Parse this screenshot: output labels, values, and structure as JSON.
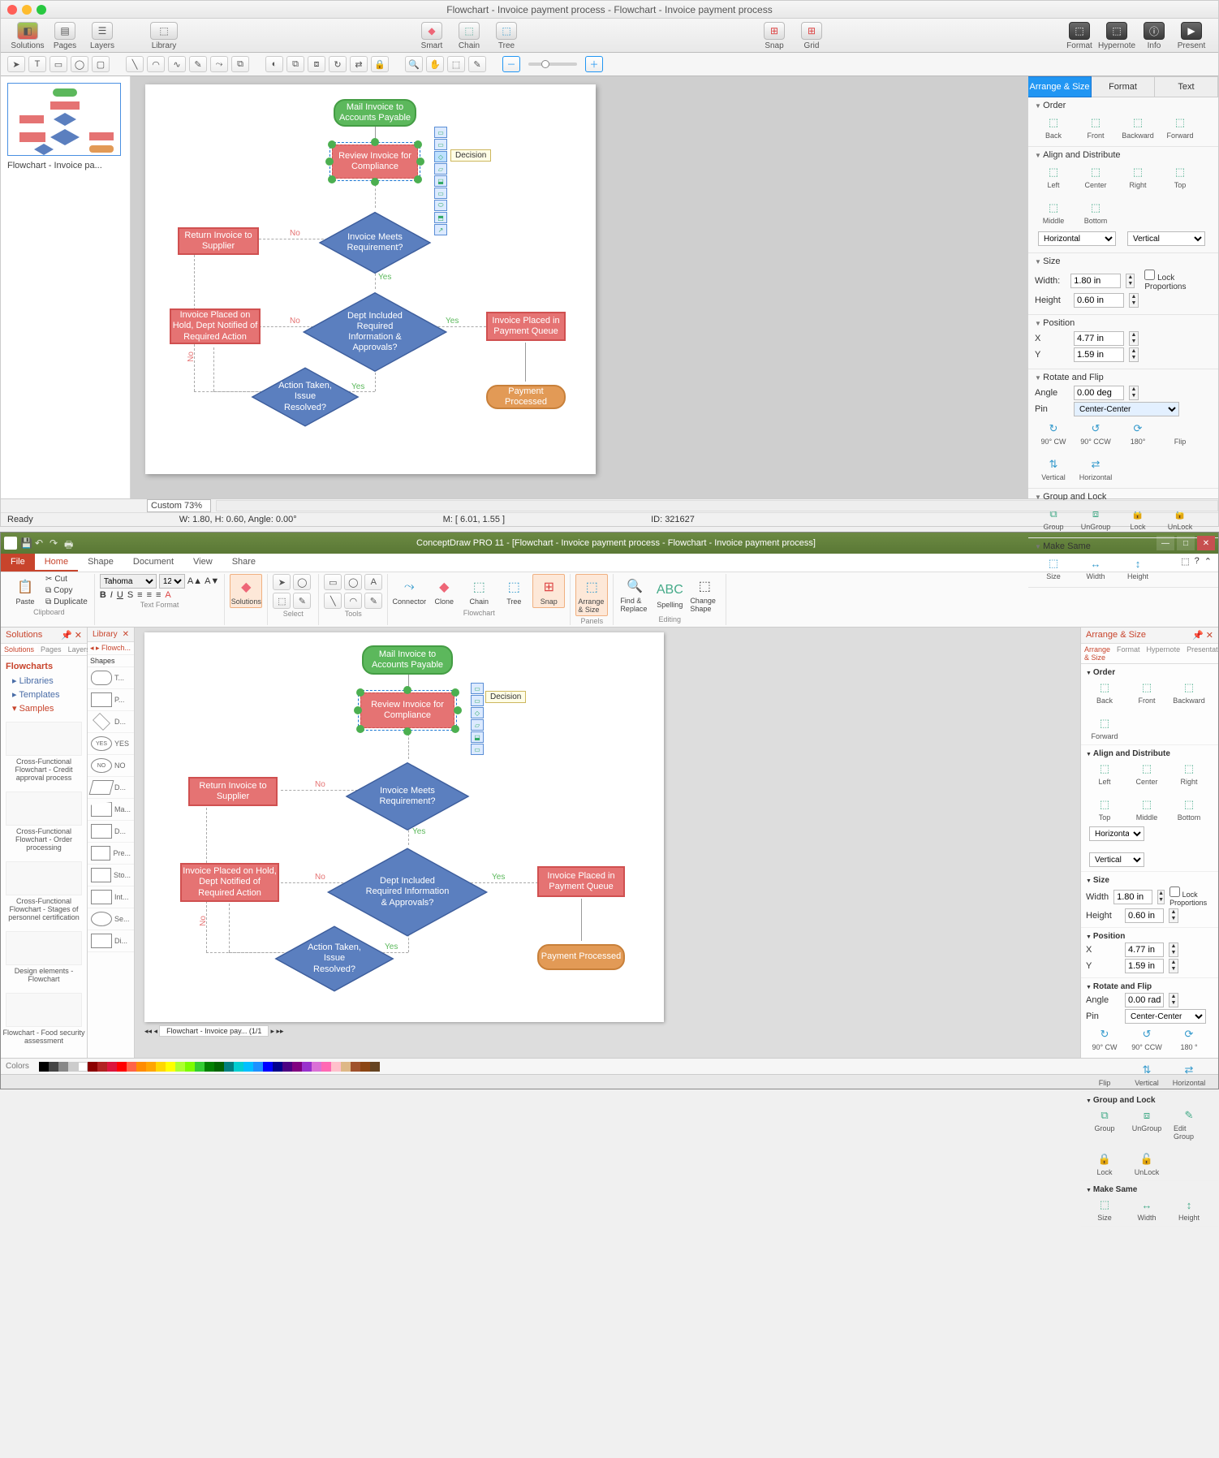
{
  "mac": {
    "title": "Flowchart - Invoice payment process - Flowchart - Invoice payment process",
    "toolbar": {
      "solutions": "Solutions",
      "pages": "Pages",
      "layers": "Layers",
      "library": "Library",
      "smart": "Smart",
      "chain": "Chain",
      "tree": "Tree",
      "snap": "Snap",
      "grid": "Grid",
      "format": "Format",
      "hypernote": "Hypernote",
      "info": "Info",
      "present": "Present"
    },
    "thumb_label": "Flowchart - Invoice pa...",
    "zoom_label": "Custom 73%",
    "status": {
      "ready": "Ready",
      "wh": "W: 1.80,  H: 0.60,  Angle: 0.00°",
      "m": "M: [ 6.01, 1.55 ]",
      "id": "ID: 321627"
    },
    "inspector": {
      "tabs": {
        "arrange": "Arrange & Size",
        "format": "Format",
        "text": "Text"
      },
      "order": {
        "title": "Order",
        "back": "Back",
        "front": "Front",
        "backward": "Backward",
        "forward": "Forward"
      },
      "align": {
        "title": "Align and Distribute",
        "left": "Left",
        "center": "Center",
        "right": "Right",
        "top": "Top",
        "middle": "Middle",
        "bottom": "Bottom",
        "horiz": "Horizontal",
        "vert": "Vertical"
      },
      "size": {
        "title": "Size",
        "width_l": "Width:",
        "width_v": "1.80 in",
        "height_l": "Height",
        "height_v": "0.60 in",
        "lock": "Lock Proportions"
      },
      "pos": {
        "title": "Position",
        "x_l": "X",
        "x_v": "4.77 in",
        "y_l": "Y",
        "y_v": "1.59 in"
      },
      "rotate": {
        "title": "Rotate and Flip",
        "angle_l": "Angle",
        "angle_v": "0.00 deg",
        "pin_l": "Pin",
        "pin_v": "Center-Center",
        "cw": "90° CW",
        "ccw": "90° CCW",
        "r180": "180°",
        "flip": "Flip",
        "fv": "Vertical",
        "fh": "Horizontal"
      },
      "group": {
        "title": "Group and Lock",
        "group": "Group",
        "ungroup": "UnGroup",
        "lock": "Lock",
        "unlock": "UnLock"
      },
      "make": {
        "title": "Make Same",
        "size": "Size",
        "width": "Width",
        "height": "Height"
      }
    },
    "tooltip": "Decision"
  },
  "flowchart": {
    "n1": "Mail Invoice to Accounts Payable",
    "n2": "Review Invoice for Compliance",
    "n3": "Return Invoice to Supplier",
    "n4": "Invoice Meets Requirement?",
    "n5": "Invoice Placed on Hold, Dept Notified of Required Action",
    "n6": "Dept Included Required Information & Approvals?",
    "n7": "Invoice Placed in Payment Queue",
    "n8": "Action Taken, Issue Resolved?",
    "n9": "Payment Processed",
    "yes": "Yes",
    "no": "No"
  },
  "win": {
    "title": "ConceptDraw PRO 11 - [Flowchart - Invoice payment process - Flowchart - Invoice payment process]",
    "tabs": {
      "file": "File",
      "home": "Home",
      "shape": "Shape",
      "document": "Document",
      "view": "View",
      "share": "Share"
    },
    "ribbon": {
      "clipboard": {
        "label": "Clipboard",
        "paste": "Paste",
        "cut": "Cut",
        "copy": "Copy",
        "dup": "Duplicate"
      },
      "textfmt": {
        "label": "Text Format",
        "font": "Tahoma",
        "size": "12"
      },
      "solutions": "Solutions",
      "select_l": "Select",
      "tools_l": "Tools",
      "connector": "Connector",
      "clone": "Clone",
      "chain": "Chain",
      "tree": "Tree",
      "snap": "Snap",
      "flowchart_l": "Flowchart",
      "arrange": "Arrange & Size",
      "panels_l": "Panels",
      "findrep": "Find & Replace",
      "spelling": "Spelling",
      "change": "Change Shape",
      "editing_l": "Editing"
    },
    "left": {
      "solutions": "Solutions",
      "library": "Library",
      "subtabs": {
        "solutions": "Solutions",
        "pages": "Pages",
        "layers": "Layers"
      },
      "flowcharts": "Flowcharts",
      "libraries": "Libraries",
      "templates": "Templates",
      "samples": "Samples",
      "s1": "Cross-Functional Flowchart - Credit approval process",
      "s2": "Cross-Functional Flowchart - Order processing",
      "s3": "Cross-Functional Flowchart - Stages of personnel certification",
      "s4": "Design elements - Flowchart",
      "s5": "Flowchart - Food security assessment",
      "lib_hdr": "Flowch...",
      "shapes": "Shapes",
      "li1": "T...",
      "li2": "P...",
      "li3": "D...",
      "li_yes": "YES",
      "li_no": "NO",
      "li4": "D...",
      "li5": "Ma...",
      "li6": "D...",
      "li7": "Pre...",
      "li8": "Sto...",
      "li9": "Int...",
      "li10": "Se...",
      "li11": "Di..."
    },
    "inspector": {
      "title": "Arrange & Size",
      "tabs": {
        "arrange": "Arrange & Size",
        "format": "Format",
        "hypernote": "Hypernote",
        "presentation": "Presentation"
      },
      "order": {
        "title": "Order",
        "back": "Back",
        "front": "Front",
        "backward": "Backward",
        "forward": "Forward"
      },
      "align": {
        "title": "Align and Distribute",
        "left": "Left",
        "center": "Center",
        "right": "Right",
        "top": "Top",
        "middle": "Middle",
        "bottom": "Bottom",
        "horiz": "Horizontal",
        "vert": "Vertical"
      },
      "size": {
        "title": "Size",
        "width_l": "Width",
        "width_v": "1.80 in",
        "height_l": "Height",
        "height_v": "0.60 in",
        "lock": "Lock Proportions"
      },
      "pos": {
        "title": "Position",
        "x_l": "X",
        "x_v": "4.77 in",
        "y_l": "Y",
        "y_v": "1.59 in"
      },
      "rotate": {
        "title": "Rotate and Flip",
        "angle_l": "Angle",
        "angle_v": "0.00 rad",
        "pin_l": "Pin",
        "pin_v": "Center-Center",
        "cw": "90° CW",
        "ccw": "90° CCW",
        "r180": "180 °",
        "flip": "Flip",
        "fv": "Vertical",
        "fh": "Horizontal"
      },
      "group": {
        "title": "Group and Lock",
        "group": "Group",
        "ungroup": "UnGroup",
        "edit": "Edit Group",
        "lock": "Lock",
        "unlock": "UnLock"
      },
      "make": {
        "title": "Make Same",
        "size": "Size",
        "width": "Width",
        "height": "Height"
      }
    },
    "doctab": "Flowchart - Invoice pay...  (1/1",
    "colors": "Colors",
    "tooltip": "Decision"
  }
}
